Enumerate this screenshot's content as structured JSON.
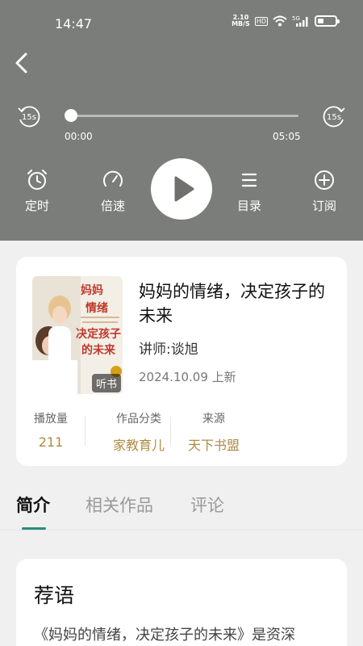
{
  "status_bar": {
    "time": "14:47",
    "net_speed_value": "2.10",
    "net_speed_unit": "MB/S",
    "hd": "HD",
    "signal": "5G"
  },
  "player": {
    "skip_back": "15s",
    "skip_forward": "15s",
    "current_time": "00:00",
    "total_time": "05:05",
    "progress": 0,
    "controls": {
      "timer": "定时",
      "speed": "倍速",
      "catalog": "目录",
      "subscribe": "订阅"
    }
  },
  "book": {
    "title": "妈妈的情绪，决定孩子的未来",
    "lecturer": "讲师:谈旭",
    "date": "2024.10.09 上新",
    "cover_badge": "听书",
    "cover_text": {
      "line1": "妈妈",
      "line2": "情绪",
      "line3": "决定孩子",
      "line4": "的未来"
    },
    "stats": [
      {
        "label": "播放量",
        "value": "211"
      },
      {
        "label": "作品分类",
        "value": "家教育儿"
      },
      {
        "label": "来源",
        "value": "天下书盟"
      }
    ]
  },
  "tabs": [
    {
      "label": "简介",
      "active": true
    },
    {
      "label": "相关作品",
      "active": false
    },
    {
      "label": "评论",
      "active": false
    }
  ],
  "recommend": {
    "title": "荐语",
    "text": "《妈妈的情绪，决定孩子的未来》是资深"
  },
  "colors": {
    "player_bg": "#7b7d7a",
    "accent": "#b08a46",
    "tab_indicator": "#2a8a7a"
  }
}
